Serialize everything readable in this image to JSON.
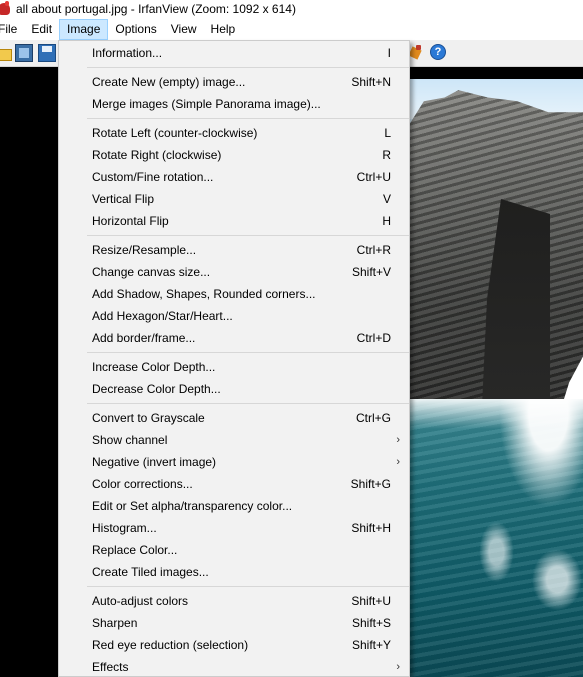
{
  "window": {
    "title": "all about portugal.jpg - IrfanView (Zoom: 1092 x 614)"
  },
  "menubar": {
    "items": [
      "File",
      "Edit",
      "Image",
      "Options",
      "View",
      "Help"
    ],
    "active": "Image"
  },
  "toolbar": {
    "icons": [
      "open-folder-icon",
      "slideshow-film-icon",
      "save-disk-icon",
      "paint-icon",
      "help-icon"
    ],
    "help_glyph": "?"
  },
  "image_menu": {
    "groups": [
      [
        {
          "label": "Information...",
          "shortcut": "I"
        }
      ],
      [
        {
          "label": "Create New (empty) image...",
          "shortcut": "Shift+N"
        },
        {
          "label": "Merge images (Simple Panorama image)...",
          "shortcut": ""
        }
      ],
      [
        {
          "label": "Rotate Left (counter-clockwise)",
          "shortcut": "L"
        },
        {
          "label": "Rotate Right (clockwise)",
          "shortcut": "R"
        },
        {
          "label": "Custom/Fine rotation...",
          "shortcut": "Ctrl+U"
        },
        {
          "label": "Vertical Flip",
          "shortcut": "V"
        },
        {
          "label": "Horizontal Flip",
          "shortcut": "H"
        }
      ],
      [
        {
          "label": "Resize/Resample...",
          "shortcut": "Ctrl+R"
        },
        {
          "label": "Change canvas size...",
          "shortcut": "Shift+V"
        },
        {
          "label": "Add Shadow, Shapes, Rounded corners...",
          "shortcut": ""
        },
        {
          "label": "Add Hexagon/Star/Heart...",
          "shortcut": ""
        },
        {
          "label": "Add border/frame...",
          "shortcut": "Ctrl+D"
        }
      ],
      [
        {
          "label": "Increase Color Depth...",
          "shortcut": ""
        },
        {
          "label": "Decrease Color Depth...",
          "shortcut": ""
        }
      ],
      [
        {
          "label": "Convert to Grayscale",
          "shortcut": "Ctrl+G"
        },
        {
          "label": "Show channel",
          "shortcut": "",
          "submenu": true
        },
        {
          "label": "Negative (invert image)",
          "shortcut": "",
          "submenu": true
        },
        {
          "label": "Color corrections...",
          "shortcut": "Shift+G"
        },
        {
          "label": "Edit or Set alpha/transparency color...",
          "shortcut": ""
        },
        {
          "label": "Histogram...",
          "shortcut": "Shift+H"
        },
        {
          "label": "Replace Color...",
          "shortcut": ""
        },
        {
          "label": "Create Tiled images...",
          "shortcut": ""
        }
      ],
      [
        {
          "label": "Auto-adjust colors",
          "shortcut": "Shift+U"
        },
        {
          "label": "Sharpen",
          "shortcut": "Shift+S"
        },
        {
          "label": "Red eye reduction (selection)",
          "shortcut": "Shift+Y"
        },
        {
          "label": "Effects",
          "shortcut": "",
          "submenu": true
        }
      ]
    ],
    "submenu_glyph": "›"
  }
}
